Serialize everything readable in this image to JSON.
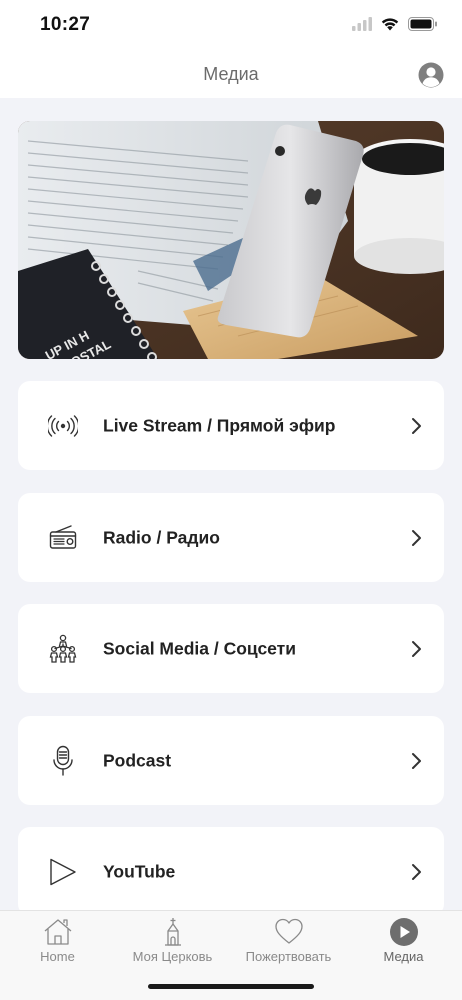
{
  "status": {
    "time": "10:27"
  },
  "nav": {
    "title": "Медиа",
    "avatar_icon": "person-circle-icon"
  },
  "hero": {
    "image": "phone-on-wooden-stand-with-newspaper-and-coffee"
  },
  "menu": [
    {
      "label": "Live Stream / Прямой эфир",
      "icon": "broadcast-icon"
    },
    {
      "label": "Radio / Радио",
      "icon": "radio-icon"
    },
    {
      "label": "Social Media / Соцсети",
      "icon": "people-icon"
    },
    {
      "label": "Podcast",
      "icon": "microphone-icon"
    },
    {
      "label": "YouTube",
      "icon": "play-icon"
    }
  ],
  "tabs": [
    {
      "label": "Home",
      "icon": "house-icon",
      "active": false
    },
    {
      "label": "Моя Церковь",
      "icon": "church-icon",
      "active": false
    },
    {
      "label": "Пожертвовать",
      "icon": "heart-icon",
      "active": false
    },
    {
      "label": "Медиа",
      "icon": "play-circle-icon",
      "active": true
    }
  ],
  "colors": {
    "background": "#f2f3f8",
    "card": "#ffffff",
    "text": "#222222",
    "nav_title": "#6b6b6b",
    "tab_inactive": "#8a8a8a",
    "tab_active_icon": "#6e6e6e"
  }
}
